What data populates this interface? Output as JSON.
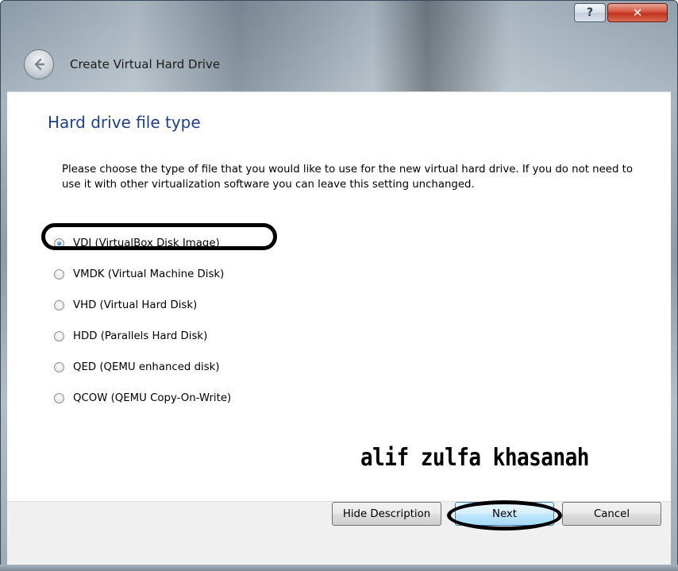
{
  "window": {
    "title": "Create Virtual Hard Drive",
    "help_label": "?",
    "close_label": "✕"
  },
  "page": {
    "heading": "Hard drive file type",
    "description": "Please choose the type of file that you would like to use for the new virtual hard drive. If you do not need to use it with other virtualization software you can leave this setting unchanged."
  },
  "options": [
    {
      "label": "VDI (VirtualBox Disk Image)",
      "selected": true
    },
    {
      "label": "VMDK (Virtual Machine Disk)",
      "selected": false
    },
    {
      "label": "VHD (Virtual Hard Disk)",
      "selected": false
    },
    {
      "label": "HDD (Parallels Hard Disk)",
      "selected": false
    },
    {
      "label": "QED (QEMU enhanced disk)",
      "selected": false
    },
    {
      "label": "QCOW (QEMU Copy-On-Write)",
      "selected": false
    }
  ],
  "watermark": "alif zulfa khasanah",
  "buttons": {
    "hide_description": "Hide Description",
    "next": "Next",
    "cancel": "Cancel"
  },
  "colors": {
    "heading": "#1e3f8a",
    "close_button": "#c2321c",
    "next_button": "#bee6fd"
  },
  "icons": {
    "back": "back-arrow-icon",
    "help": "help-icon",
    "close": "close-icon"
  }
}
